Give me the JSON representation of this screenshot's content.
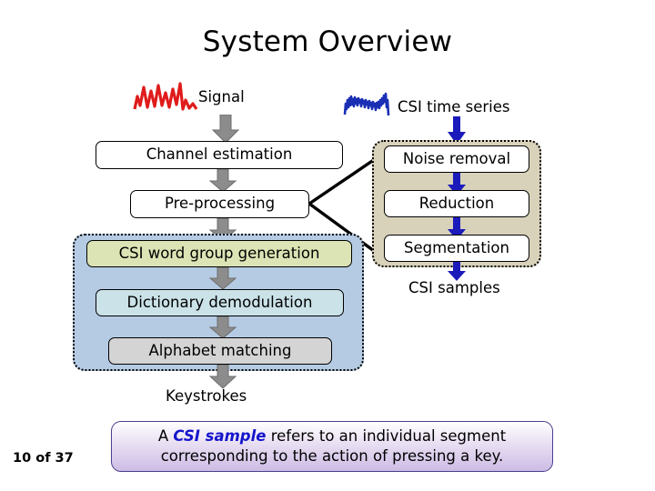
{
  "slide": {
    "title": "System Overview",
    "page_label": "10 of 37"
  },
  "icons": {
    "signal_waveform": "red-waveform-icon",
    "csi_waveform": "blue-waveform-icon",
    "signal_color": "#e01b1b",
    "csi_color": "#1b2fb5"
  },
  "labels": {
    "signal": "Signal",
    "csi_time_series": "CSI time series",
    "csi_samples": "CSI samples",
    "keystrokes": "Keystrokes"
  },
  "left_column": {
    "steps": [
      {
        "label": "Channel estimation",
        "fill": "#ffffff"
      },
      {
        "label": "Pre-processing",
        "fill": "#ffffff"
      }
    ],
    "group": {
      "fill": "#b5cbe3",
      "steps": [
        {
          "label": "CSI word group generation",
          "fill": "#dce3b4"
        },
        {
          "label": "Dictionary demodulation",
          "fill": "#cae2e8"
        },
        {
          "label": "Alphabet matching",
          "fill": "#d4d4d4"
        }
      ]
    }
  },
  "right_column": {
    "group": {
      "fill": "#d8d2bb",
      "steps": [
        {
          "label": "Noise removal",
          "fill": "#ffffff"
        },
        {
          "label": "Reduction",
          "fill": "#ffffff"
        },
        {
          "label": "Segmentation",
          "fill": "#ffffff"
        }
      ]
    }
  },
  "arrows": {
    "gray_color": "#8c8c8c",
    "blue_color": "#1b1bbb",
    "connector_color": "#000000"
  },
  "callout": {
    "text_before": "A ",
    "emphasis": "CSI sample",
    "text_after": " refers to an individual segment corresponding to the action of pressing a key.",
    "accent": "#1515cc"
  }
}
